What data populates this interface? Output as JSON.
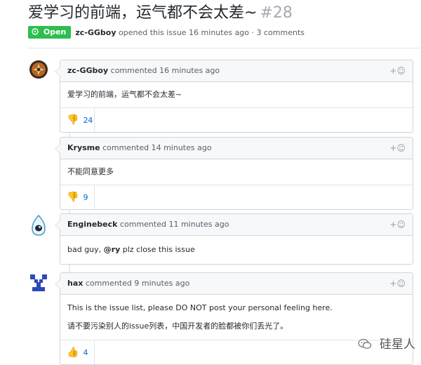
{
  "issue": {
    "title": "爱学习的前端，运气都不会太差~",
    "number": "#28",
    "state": "Open",
    "state_icon": "issue-opened-icon",
    "author": "zc-GGboy",
    "meta": "opened this issue 16 minutes ago · 3 comments"
  },
  "comments": [
    {
      "author": "zc-GGboy",
      "action": "commented 16 minutes ago",
      "body": [
        "爱学习的前端，运气都不会太差~"
      ],
      "reaction": {
        "emoji": "thumbs-down",
        "glyph": "👎",
        "count": "24"
      }
    },
    {
      "author": "Krysme",
      "action": "commented 14 minutes ago",
      "body": [
        "不能同意更多"
      ],
      "reaction": {
        "emoji": "thumbs-down",
        "glyph": "👎",
        "count": "9"
      }
    },
    {
      "author": "Enginebeck",
      "action": "commented 11 minutes ago",
      "body_prefix": "bad guy, ",
      "body_mention": "@ry",
      "body_suffix": " plz close this issue"
    },
    {
      "author": "hax",
      "action": "commented 9 minutes ago",
      "body": [
        "This is the issue list, please DO NOT post your personal feeling here.",
        "请不要污染别人的issue列表，中国开发者的脸都被你们丢光了。"
      ],
      "reaction": {
        "emoji": "thumbs-up",
        "glyph": "👍",
        "count": "4"
      }
    }
  ],
  "add_reaction_glyph": "+☺",
  "watermark": {
    "text": "硅星人",
    "icon": "wechat-icon"
  },
  "colors": {
    "open_green": "#2cbe4e",
    "link_blue": "#0366d6",
    "number_gray": "#a3aab1"
  }
}
